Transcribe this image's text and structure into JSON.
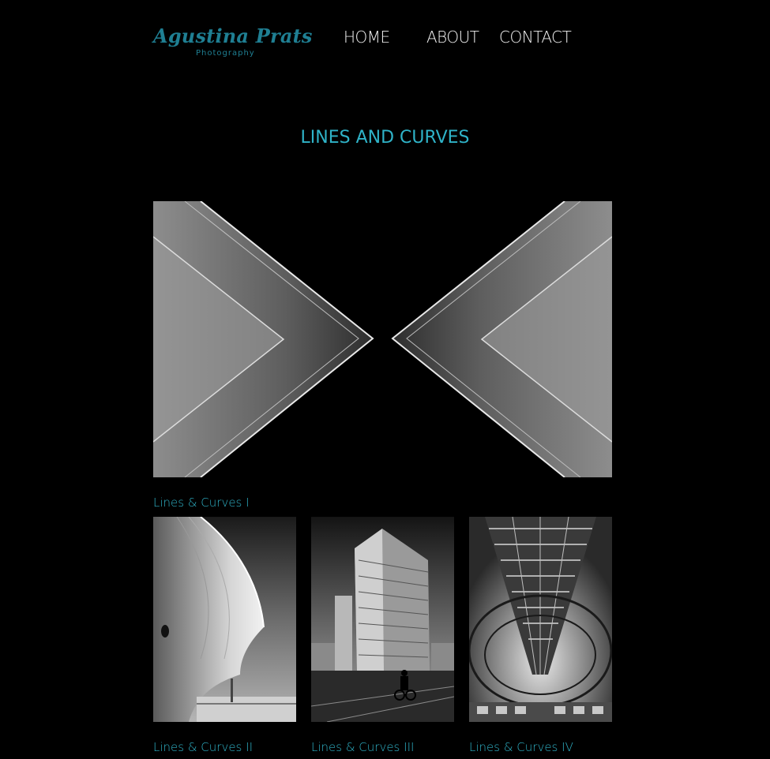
{
  "site": {
    "logo_script": "Agustina Prats",
    "logo_sub": "Photography"
  },
  "nav": {
    "home": "HOME",
    "about": "ABOUT",
    "contact": "CONTACT"
  },
  "page": {
    "title": "LINES AND CURVES"
  },
  "gallery": [
    {
      "caption": "Lines & Curves I"
    },
    {
      "caption": "Lines & Curves II"
    },
    {
      "caption": "Lines & Curves III"
    },
    {
      "caption": "Lines & Curves IV"
    }
  ],
  "colors": {
    "background": "#000000",
    "accent": "#2fb3c8",
    "logo": "#1f7f93",
    "nav_text": "#f2f2f2"
  }
}
